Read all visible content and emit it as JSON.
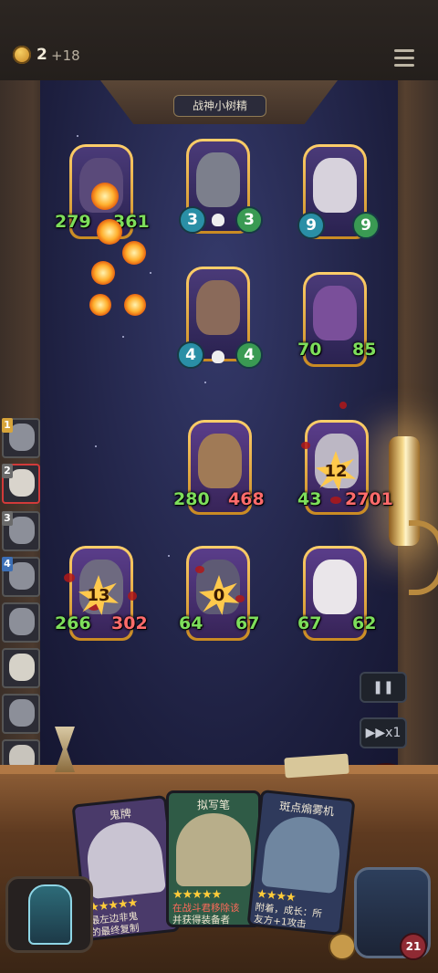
{
  "hud": {
    "gold": "2",
    "gold_income": "+18",
    "menu_icon": "hamburger-menu-icon"
  },
  "board": {
    "title": "战神小树精",
    "enemy_row1": [
      {
        "atk": "279",
        "hp": "361",
        "hp_color": "green"
      },
      {
        "atk": "3",
        "hp": "3",
        "badge": true
      },
      {
        "atk": "9",
        "hp": "9",
        "badge": true
      }
    ],
    "enemy_row2": [
      {
        "atk": "4",
        "hp": "4",
        "badge": true
      },
      {
        "atk": "70",
        "hp": "85"
      }
    ],
    "player_row1": [
      {
        "atk": "280",
        "hp": "468",
        "hp_color": "red"
      },
      {
        "atk": "43",
        "hp": "2701",
        "hp_color": "red",
        "hit": "12"
      }
    ],
    "player_row2": [
      {
        "atk": "266",
        "hp": "302",
        "hp_color": "red",
        "hit": "13"
      },
      {
        "atk": "64",
        "hp": "67",
        "hit": "0"
      },
      {
        "atk": "67",
        "hp": "62"
      }
    ]
  },
  "queue": [
    {
      "num": "1",
      "color": "#d7a43a"
    },
    {
      "num": "2",
      "color": "#6a6a6a",
      "active": true
    },
    {
      "num": "3",
      "color": "#6a6a6a"
    },
    {
      "num": "4",
      "color": "#3d6fb5"
    },
    {
      "num": "",
      "color": ""
    },
    {
      "num": "",
      "color": ""
    },
    {
      "num": "",
      "color": ""
    },
    {
      "num": "",
      "color": ""
    }
  ],
  "controls": {
    "pause_icon": "pause-icon",
    "speed_label": "x1",
    "power_icon": "power-icon"
  },
  "hand": [
    {
      "title": "鬼牌",
      "stars": "★★★★★",
      "text": "最左边非鬼",
      "text2": "的最终复制",
      "bg": "#4a3a6a"
    },
    {
      "title": "拟写笔",
      "stars": "★★★★★",
      "text_red": "在战斗君移除该",
      "text": "并获得装备者",
      "text2": "最终复制",
      "bg": "#2f5b46"
    },
    {
      "title": "斑点煽雾机",
      "stars": "★★★★",
      "text": "附着，成长：所",
      "text2": "友方+1攻击",
      "bg": "#2f3a5c"
    }
  ],
  "hero": {
    "hp": "21"
  },
  "colors": {
    "atk_green": "#7dde5b",
    "hp_red": "#ff6b6b",
    "card_gold": "#e3a63a",
    "board_bg": "#1d1f3f"
  }
}
